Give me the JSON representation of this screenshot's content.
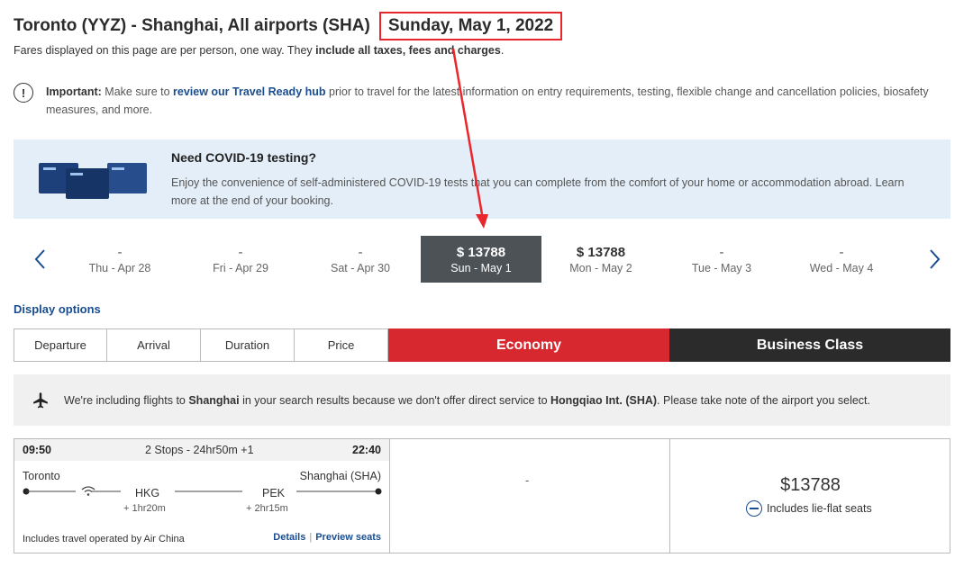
{
  "header": {
    "route": "Toronto (YYZ) - Shanghai, All airports (SHA)",
    "date": "Sunday, May 1, 2022",
    "fares_prefix": "Fares displayed on this page are per person, one way. They ",
    "fares_bold": "include all taxes, fees and charges",
    "fares_suffix": "."
  },
  "important": {
    "label": "Important:",
    "text1": " Make sure to ",
    "link": "review our Travel Ready hub",
    "text2": " prior to travel for the latest information on entry requirements, testing, flexible change and cancellation policies, biosafety measures, and more."
  },
  "covid": {
    "title": "Need COVID-19 testing?",
    "text": "Enjoy the convenience of self-administered COVID-19 tests that you can complete from the comfort of your home or accommodation abroad. Learn more at the end of your booking."
  },
  "dates": [
    {
      "price": "-",
      "label": "Thu - Apr 28"
    },
    {
      "price": "-",
      "label": "Fri - Apr 29"
    },
    {
      "price": "-",
      "label": "Sat - Apr 30"
    },
    {
      "price": "$ 13788",
      "label": "Sun - May 1"
    },
    {
      "price": "$ 13788",
      "label": "Mon - May 2"
    },
    {
      "price": "-",
      "label": "Tue - May 3"
    },
    {
      "price": "-",
      "label": "Wed - May 4"
    }
  ],
  "display_options": "Display options",
  "sort": [
    "Departure",
    "Arrival",
    "Duration",
    "Price"
  ],
  "cabins": {
    "economy": "Economy",
    "business": "Business Class"
  },
  "notice": {
    "t1": "We're including flights to ",
    "b1": "Shanghai",
    "t2": " in your search results because we don't offer direct service to ",
    "b2": "Hongqiao Int. (SHA)",
    "t3": ". Please take note of the airport you select."
  },
  "flight": {
    "departure": "09:50",
    "stops": "2 Stops - 24hr50m +1",
    "arrival": "22:40",
    "origin": "Toronto",
    "destination": "Shanghai (SHA)",
    "stop1_code": "HKG",
    "stop1_dur": "+ 1hr20m",
    "stop2_code": "PEK",
    "stop2_dur": "+ 2hr15m",
    "operated": "Includes travel operated by Air China",
    "details": "Details",
    "separator": "|",
    "preview": "Preview seats",
    "economy": "-",
    "business_price": "$13788",
    "business_feature": "Includes lie-flat seats"
  },
  "colors": {
    "accent_red": "#d7282f",
    "link_blue": "#1a4d8f",
    "selected_date": "#4d5257",
    "business_dark": "#2b2b2b",
    "annotation_red": "#e8262b"
  },
  "icons": [
    "exclamation-icon",
    "chevron-left-icon",
    "chevron-right-icon",
    "plane-icon",
    "wifi-icon",
    "lie-flat-seat-icon"
  ]
}
